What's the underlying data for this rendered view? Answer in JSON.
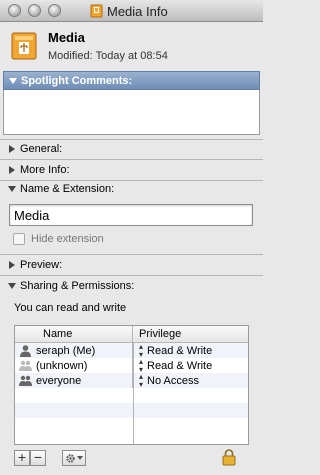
{
  "window": {
    "title": "Media Info"
  },
  "header": {
    "name": "Media",
    "modified_label": "Modified:",
    "modified_value": "Today at 08:54"
  },
  "sections": {
    "spotlight": "Spotlight Comments:",
    "general": "General:",
    "more_info": "More Info:",
    "name_ext": "Name & Extension:",
    "preview": "Preview:",
    "sharing": "Sharing & Permissions:"
  },
  "name_extension": {
    "name_value": "Media",
    "hide_label": "Hide extension",
    "hide_checked": false
  },
  "sharing": {
    "summary": "You can read and write",
    "columns": {
      "name": "Name",
      "privilege": "Privilege"
    },
    "rows": [
      {
        "name": "seraph (Me)",
        "privilege": "Read & Write",
        "icon": "single-user-icon"
      },
      {
        "name": "(unknown)",
        "privilege": "Read & Write",
        "icon": "group-faded-icon"
      },
      {
        "name": "everyone",
        "privilege": "No Access",
        "icon": "group-icon"
      }
    ]
  },
  "toolbar": {
    "add": "+",
    "remove": "−"
  },
  "colors": {
    "spotlight_header": "#7f9ac0"
  }
}
